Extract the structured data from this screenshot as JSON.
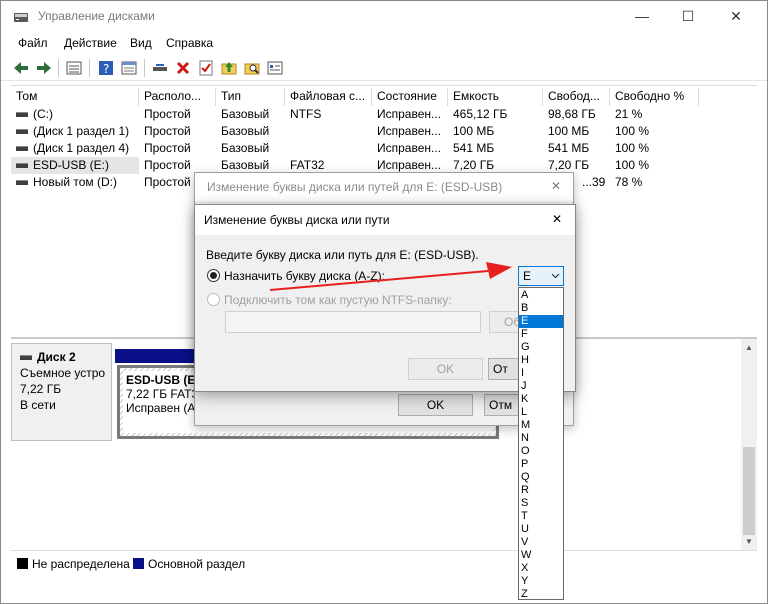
{
  "window": {
    "title": "Управление дисками",
    "caption_minimize": "—",
    "caption_maximize": "☐",
    "caption_close": "✕"
  },
  "menu": [
    "Файл",
    "Действие",
    "Вид",
    "Справка"
  ],
  "toolbar": [
    "back-icon",
    "forward-icon",
    "list-view-icon",
    "help-icon",
    "properties-icon",
    "connect-icon",
    "delete-icon",
    "check-icon",
    "up-folder-icon",
    "search-folder-icon",
    "info-icon"
  ],
  "volumes": {
    "columns": [
      "Том",
      "Располо...",
      "Тип",
      "Файловая с...",
      "Состояние",
      "Емкость",
      "Свобод...",
      "Свободно %"
    ],
    "rows": [
      [
        "(C:)",
        "Простой",
        "Базовый",
        "NTFS",
        "Исправен...",
        "465,12 ГБ",
        "98,68 ГБ",
        "21 %"
      ],
      [
        "(Диск 1 раздел 1)",
        "Простой",
        "Базовый",
        "",
        "Исправен...",
        "100 МБ",
        "100 МБ",
        "100 %"
      ],
      [
        "(Диск 1 раздел 4)",
        "Простой",
        "Базовый",
        "",
        "Исправен...",
        "541 МБ",
        "541 МБ",
        "100 %"
      ],
      [
        "ESD-USB (E:)",
        "Простой",
        "Базовый",
        "FAT32",
        "Исправен...",
        "7,20 ГБ",
        "7,20 ГБ",
        "100 %"
      ],
      [
        "Новый том (D:)",
        "Простой",
        "",
        "",
        "",
        "",
        "...39",
        "78 %"
      ]
    ]
  },
  "disk": {
    "name": "Диск 2",
    "type": "Съемное устро",
    "size": "7,22 ГБ",
    "status": "В сети",
    "partition_name": "ESD-USB (E:)",
    "partition_size": "7,22 ГБ FAT32",
    "partition_status": "Исправен (Ак"
  },
  "legend": {
    "unallocated": "Не распределена",
    "primary": "Основной раздел",
    "unallocated_color": "#000000",
    "primary_color": "#0a108a"
  },
  "parent_dialog": {
    "title": "Изменение буквы диска или путей для E: (ESD-USB)",
    "close": "✕",
    "ok": "OK",
    "cancel_partial": "Отм"
  },
  "dialog": {
    "title": "Изменение буквы диска или пути",
    "close": "✕",
    "prompt": "Введите букву диска или путь для E: (ESD-USB).",
    "option_letter": "Назначить букву диска (A-Z):",
    "option_folder": "Подключить том как пустую NTFS-папку:",
    "browse_partial": "Об",
    "ok": "OK",
    "cancel_partial": "От"
  },
  "drive_letter": {
    "selected": "E",
    "options": [
      "A",
      "B",
      "E",
      "F",
      "G",
      "H",
      "I",
      "J",
      "K",
      "L",
      "M",
      "N",
      "O",
      "P",
      "Q",
      "R",
      "S",
      "T",
      "U",
      "V",
      "W",
      "X",
      "Y",
      "Z"
    ]
  }
}
